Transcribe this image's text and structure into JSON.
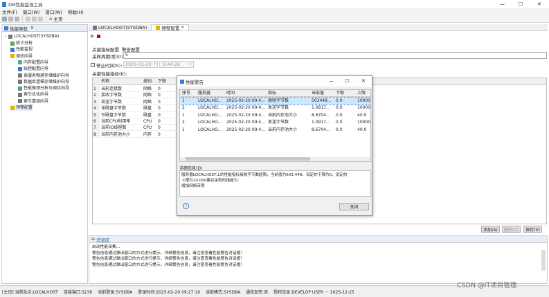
{
  "window": {
    "title": "DM性能监视工具",
    "minimize": "—",
    "maximize": "☐",
    "close": "✕"
  },
  "menu": [
    "文件(F)",
    "窗口(W)",
    "窗口(W)",
    "帮助(H)"
  ],
  "toolbar": {
    "home_label": "主页"
  },
  "nav": {
    "title": "性能导航",
    "close": "✕",
    "root": "LOCALHOST(SYSDBA)",
    "items": [
      {
        "label": "统计分析",
        "level": 1
      },
      {
        "label": "性能监视",
        "level": 1
      },
      {
        "label": "调优向导",
        "level": 1
      },
      {
        "label": "内存配置向导",
        "level": 2
      },
      {
        "label": "线程配置向导",
        "level": 2
      },
      {
        "label": "表服务物理存储维护向导",
        "level": 2
      },
      {
        "label": "数据库逻辑存储维护向导",
        "level": 2
      },
      {
        "label": "性能瓶颈分析与调优向导",
        "level": 2
      },
      {
        "label": "索引优化向导",
        "level": 2
      },
      {
        "label": "索引重组向导",
        "level": 2
      },
      {
        "label": "预警配置",
        "level": 1
      }
    ]
  },
  "tabs": [
    {
      "label": "LOCALHOST(SYSDBA)",
      "active": false
    },
    {
      "label": "预警配置",
      "active": true,
      "close": "✕"
    }
  ],
  "config": {
    "subtabs": [
      "关键指标配置",
      "警告配置"
    ],
    "period_label": "采样周期(秒)(I):",
    "period_value": "5",
    "stop_label": "停止时间(S):",
    "stop_date": "2025-02-20",
    "stop_time": "9:44:26",
    "table_label": "关键性能指标(K):",
    "columns": [
      "名称",
      "类别",
      "下限"
    ],
    "rows": [
      {
        "n": "1",
        "name": "当前连接数",
        "cat": "网络",
        "low": "0"
      },
      {
        "n": "2",
        "name": "接收字节数",
        "cat": "网络",
        "low": "0"
      },
      {
        "n": "3",
        "name": "发送字节数",
        "cat": "网络",
        "low": "0"
      },
      {
        "n": "4",
        "name": "读磁盘字节数",
        "cat": "磁盘",
        "low": "0"
      },
      {
        "n": "5",
        "name": "写磁盘字节数",
        "cat": "磁盘",
        "low": "0"
      },
      {
        "n": "6",
        "name": "当前CPU利用率",
        "cat": "CPU",
        "low": "0"
      },
      {
        "n": "7",
        "name": "当前IO线程数",
        "cat": "CPU",
        "low": "0"
      },
      {
        "n": "8",
        "name": "当前内存池大小",
        "cat": "内存",
        "low": "0"
      }
    ],
    "add_button": "添加(A)",
    "delete_button": "删除(D)",
    "save_button": "保存(V)"
  },
  "messages": {
    "title": "消息区",
    "lines": [
      "启动性能采集...",
      "警告信息通过弹出窗口的方式进行提示，详细警告信息，请注意查看性能警告对话框！",
      "警告信息通过弹出窗口的方式进行提示，详细警告信息，请注意查看性能警告对话框！",
      "警告信息通过弹出窗口的方式进行提示，详细警告信息，请注意查看性能警告对话框！"
    ]
  },
  "dialog": {
    "title": "性能警告",
    "minimize": "—",
    "maximize": "☐",
    "close": "✕",
    "columns": [
      "序号",
      "服务器",
      "时间",
      "指标",
      "当前值",
      "下限",
      "上限"
    ],
    "rows": [
      {
        "n": "1",
        "server": "LOCALHO...",
        "time": "2025-02-20 09:4...",
        "metric": "接收字节数",
        "value": "503448...",
        "low": "0.0",
        "high": "10000.0",
        "selected": true
      },
      {
        "n": "2",
        "server": "LOCALHO...",
        "time": "2025-02-20 09:4...",
        "metric": "发送字节数",
        "value": "1.0917...",
        "low": "0.0",
        "high": "10000.0",
        "selected": false
      },
      {
        "n": "1",
        "server": "LOCALHO...",
        "time": "2025-02-20 09:4...",
        "metric": "当前内存池大小",
        "value": "8.6704...",
        "low": "0.0",
        "high": "40.0",
        "selected": false
      },
      {
        "n": "2",
        "server": "LOCALHO...",
        "time": "2025-02-20 09:4...",
        "metric": "发送字节数",
        "value": "1.0917...",
        "low": "0.0",
        "high": "10000.0",
        "selected": false
      },
      {
        "n": "1",
        "server": "LOCALHO...",
        "time": "2025-02-20 09:4...",
        "metric": "当前内存池大小",
        "value": "8.6704...",
        "low": "0.0",
        "high": "40.0",
        "selected": false
      }
    ],
    "detail_label": "详细信息(D)",
    "detail_lines": [
      "服务器LOCALHOST上的性能指标接收字节数超限，当前值为503,448，设定的下限为0，设定的",
      "上限为10,000建议采取的措施为:",
      "增加网络带宽"
    ],
    "help": "?",
    "close_button": "关闭"
  },
  "status": {
    "items": [
      "[主页] 当前站点:LOCALHOST",
      "连接端口:5236",
      "当前登录:SYSDBA",
      "登录时间:2025-02-20 09:27:16",
      "当前模式:SYSDBA",
      "通信加密:否",
      "授权信息:DEVELOP USER － 2025-12-25"
    ],
    "watermark": "CSDN @IT项目管理"
  },
  "colors": {
    "selection": "#cce8ff",
    "accent": "#1a5fb4",
    "tab_active": "#ffffff"
  }
}
